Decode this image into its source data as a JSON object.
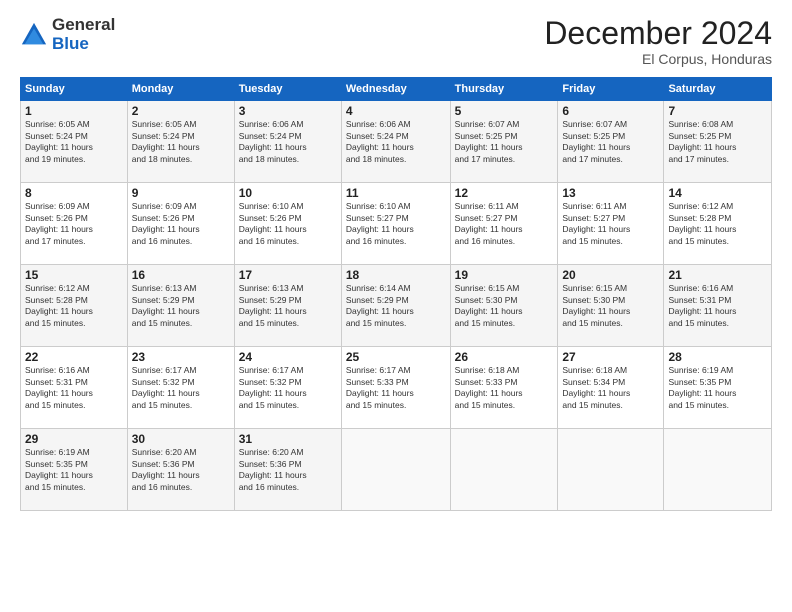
{
  "header": {
    "title": "December 2024",
    "subtitle": "El Corpus, Honduras"
  },
  "calendar": {
    "headers": [
      "Sunday",
      "Monday",
      "Tuesday",
      "Wednesday",
      "Thursday",
      "Friday",
      "Saturday"
    ],
    "weeks": [
      [
        {
          "day": "1",
          "info": "Sunrise: 6:05 AM\nSunset: 5:24 PM\nDaylight: 11 hours\nand 19 minutes."
        },
        {
          "day": "2",
          "info": "Sunrise: 6:05 AM\nSunset: 5:24 PM\nDaylight: 11 hours\nand 18 minutes."
        },
        {
          "day": "3",
          "info": "Sunrise: 6:06 AM\nSunset: 5:24 PM\nDaylight: 11 hours\nand 18 minutes."
        },
        {
          "day": "4",
          "info": "Sunrise: 6:06 AM\nSunset: 5:24 PM\nDaylight: 11 hours\nand 18 minutes."
        },
        {
          "day": "5",
          "info": "Sunrise: 6:07 AM\nSunset: 5:25 PM\nDaylight: 11 hours\nand 17 minutes."
        },
        {
          "day": "6",
          "info": "Sunrise: 6:07 AM\nSunset: 5:25 PM\nDaylight: 11 hours\nand 17 minutes."
        },
        {
          "day": "7",
          "info": "Sunrise: 6:08 AM\nSunset: 5:25 PM\nDaylight: 11 hours\nand 17 minutes."
        }
      ],
      [
        {
          "day": "8",
          "info": "Sunrise: 6:09 AM\nSunset: 5:26 PM\nDaylight: 11 hours\nand 17 minutes."
        },
        {
          "day": "9",
          "info": "Sunrise: 6:09 AM\nSunset: 5:26 PM\nDaylight: 11 hours\nand 16 minutes."
        },
        {
          "day": "10",
          "info": "Sunrise: 6:10 AM\nSunset: 5:26 PM\nDaylight: 11 hours\nand 16 minutes."
        },
        {
          "day": "11",
          "info": "Sunrise: 6:10 AM\nSunset: 5:27 PM\nDaylight: 11 hours\nand 16 minutes."
        },
        {
          "day": "12",
          "info": "Sunrise: 6:11 AM\nSunset: 5:27 PM\nDaylight: 11 hours\nand 16 minutes."
        },
        {
          "day": "13",
          "info": "Sunrise: 6:11 AM\nSunset: 5:27 PM\nDaylight: 11 hours\nand 15 minutes."
        },
        {
          "day": "14",
          "info": "Sunrise: 6:12 AM\nSunset: 5:28 PM\nDaylight: 11 hours\nand 15 minutes."
        }
      ],
      [
        {
          "day": "15",
          "info": "Sunrise: 6:12 AM\nSunset: 5:28 PM\nDaylight: 11 hours\nand 15 minutes."
        },
        {
          "day": "16",
          "info": "Sunrise: 6:13 AM\nSunset: 5:29 PM\nDaylight: 11 hours\nand 15 minutes."
        },
        {
          "day": "17",
          "info": "Sunrise: 6:13 AM\nSunset: 5:29 PM\nDaylight: 11 hours\nand 15 minutes."
        },
        {
          "day": "18",
          "info": "Sunrise: 6:14 AM\nSunset: 5:29 PM\nDaylight: 11 hours\nand 15 minutes."
        },
        {
          "day": "19",
          "info": "Sunrise: 6:15 AM\nSunset: 5:30 PM\nDaylight: 11 hours\nand 15 minutes."
        },
        {
          "day": "20",
          "info": "Sunrise: 6:15 AM\nSunset: 5:30 PM\nDaylight: 11 hours\nand 15 minutes."
        },
        {
          "day": "21",
          "info": "Sunrise: 6:16 AM\nSunset: 5:31 PM\nDaylight: 11 hours\nand 15 minutes."
        }
      ],
      [
        {
          "day": "22",
          "info": "Sunrise: 6:16 AM\nSunset: 5:31 PM\nDaylight: 11 hours\nand 15 minutes."
        },
        {
          "day": "23",
          "info": "Sunrise: 6:17 AM\nSunset: 5:32 PM\nDaylight: 11 hours\nand 15 minutes."
        },
        {
          "day": "24",
          "info": "Sunrise: 6:17 AM\nSunset: 5:32 PM\nDaylight: 11 hours\nand 15 minutes."
        },
        {
          "day": "25",
          "info": "Sunrise: 6:17 AM\nSunset: 5:33 PM\nDaylight: 11 hours\nand 15 minutes."
        },
        {
          "day": "26",
          "info": "Sunrise: 6:18 AM\nSunset: 5:33 PM\nDaylight: 11 hours\nand 15 minutes."
        },
        {
          "day": "27",
          "info": "Sunrise: 6:18 AM\nSunset: 5:34 PM\nDaylight: 11 hours\nand 15 minutes."
        },
        {
          "day": "28",
          "info": "Sunrise: 6:19 AM\nSunset: 5:35 PM\nDaylight: 11 hours\nand 15 minutes."
        }
      ],
      [
        {
          "day": "29",
          "info": "Sunrise: 6:19 AM\nSunset: 5:35 PM\nDaylight: 11 hours\nand 15 minutes."
        },
        {
          "day": "30",
          "info": "Sunrise: 6:20 AM\nSunset: 5:36 PM\nDaylight: 11 hours\nand 16 minutes."
        },
        {
          "day": "31",
          "info": "Sunrise: 6:20 AM\nSunset: 5:36 PM\nDaylight: 11 hours\nand 16 minutes."
        },
        {
          "day": "",
          "info": ""
        },
        {
          "day": "",
          "info": ""
        },
        {
          "day": "",
          "info": ""
        },
        {
          "day": "",
          "info": ""
        }
      ]
    ]
  }
}
